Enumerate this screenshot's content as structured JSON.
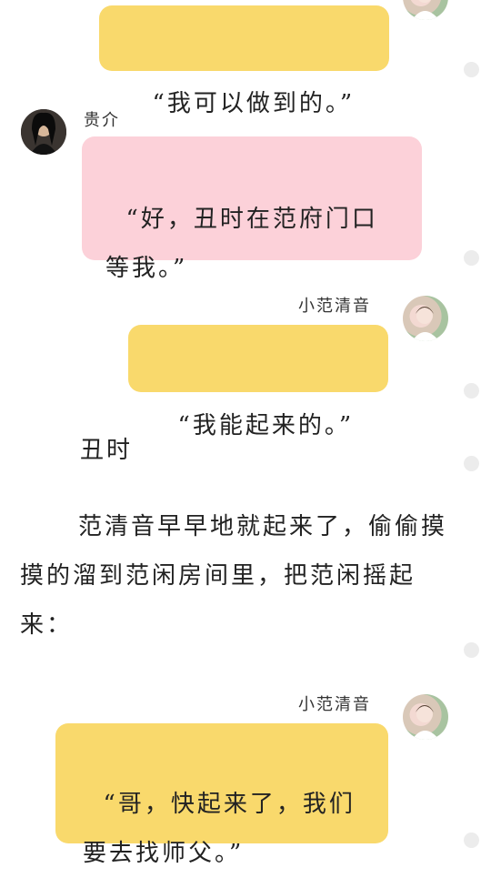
{
  "messages": [
    {
      "text": "“我可以做到的。”"
    },
    {
      "name": "贵介",
      "text": "“好，丑时在范府门口等我。”"
    },
    {
      "name": "小范清音",
      "text": "“我能起来的。”"
    },
    {
      "name": "小范清音",
      "text": "“哥，快起来了，我们要去找师父。”"
    }
  ],
  "narration": {
    "time_label": "丑时",
    "paragraph": "范清音早早地就起来了，偷偷摸摸的溜到范闲房间里，把范闲摇起来："
  }
}
